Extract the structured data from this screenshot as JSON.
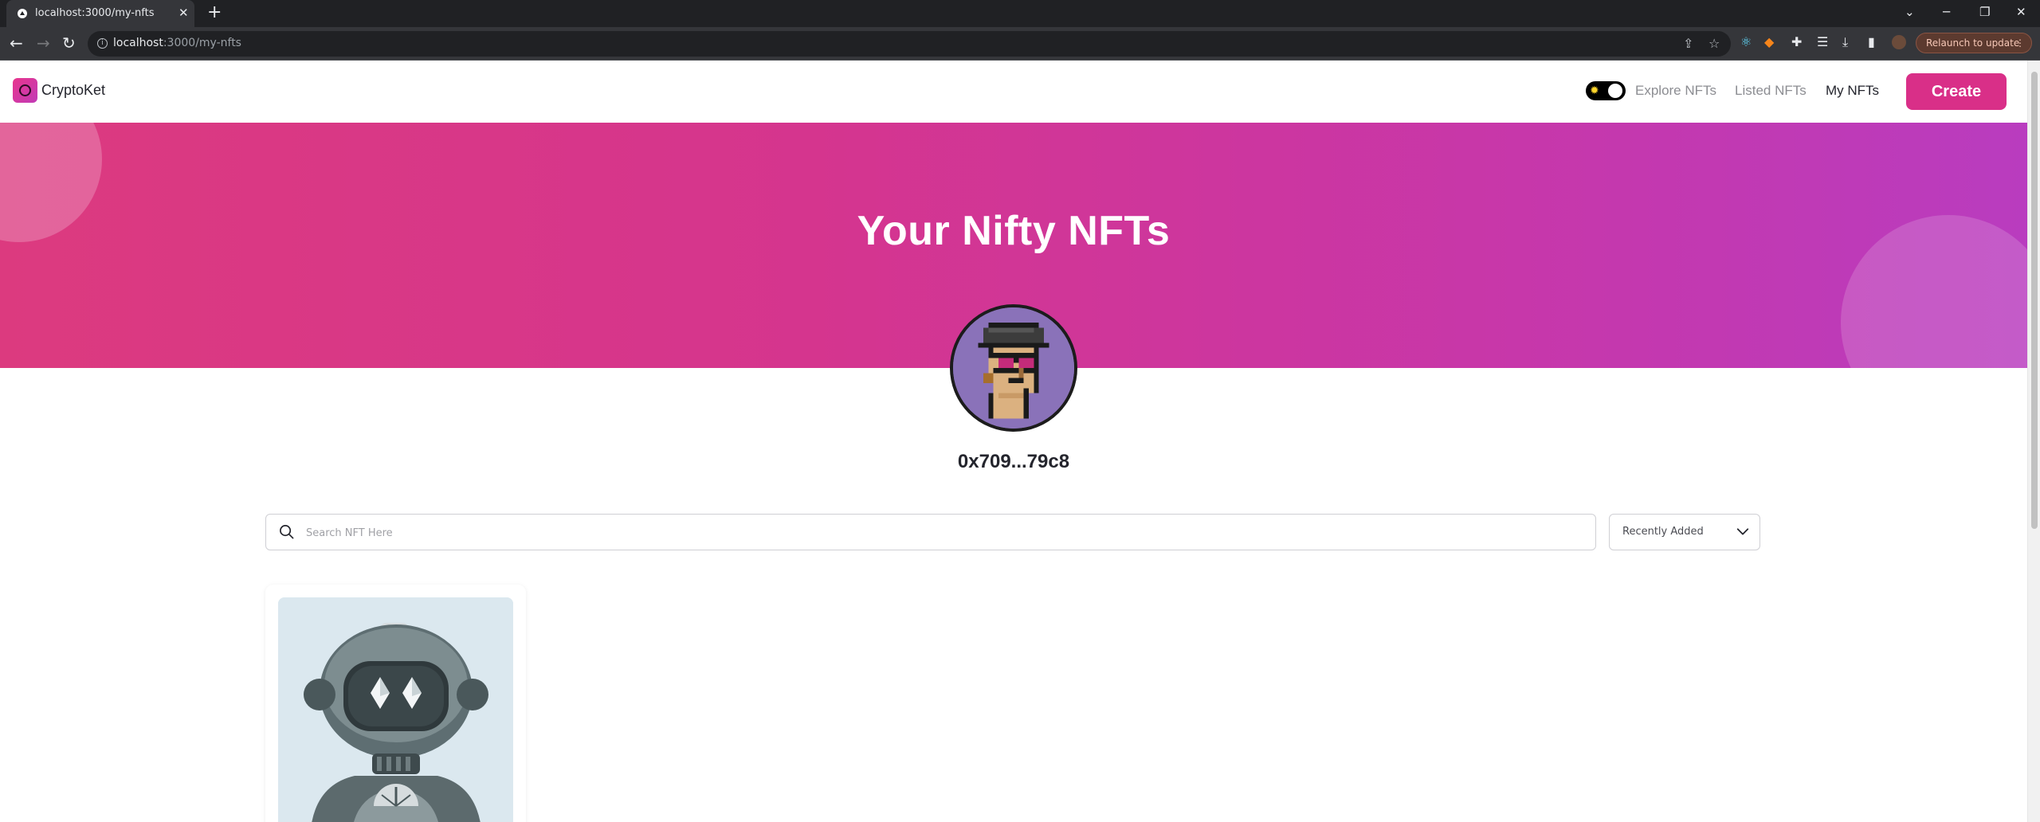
{
  "browser": {
    "tab_title": "localhost:3000/my-nfts",
    "url_host": "localhost",
    "url_path": ":3000/my-nfts",
    "relaunch_label": "Relaunch to update"
  },
  "navbar": {
    "logo_text": "CryptoKet",
    "links": [
      "Explore NFTs",
      "Listed NFTs",
      "My NFTs"
    ],
    "active_link": "My NFTs",
    "create_label": "Create",
    "theme_toggle": "dark"
  },
  "banner": {
    "title": "Your Nifty NFTs"
  },
  "profile": {
    "wallet_address": "0x709...79c8"
  },
  "search": {
    "placeholder": "Search NFT Here",
    "value": ""
  },
  "sort": {
    "selected": "Recently Added"
  },
  "colors": {
    "brand_pink": "#d92f88",
    "banner_start": "#dc3a7f",
    "banner_end": "#b93cbf",
    "text_dark": "#24252d",
    "text_muted": "#8c8d92"
  },
  "nft_cards": [
    {
      "image_icon": "robot-nft-image"
    }
  ]
}
